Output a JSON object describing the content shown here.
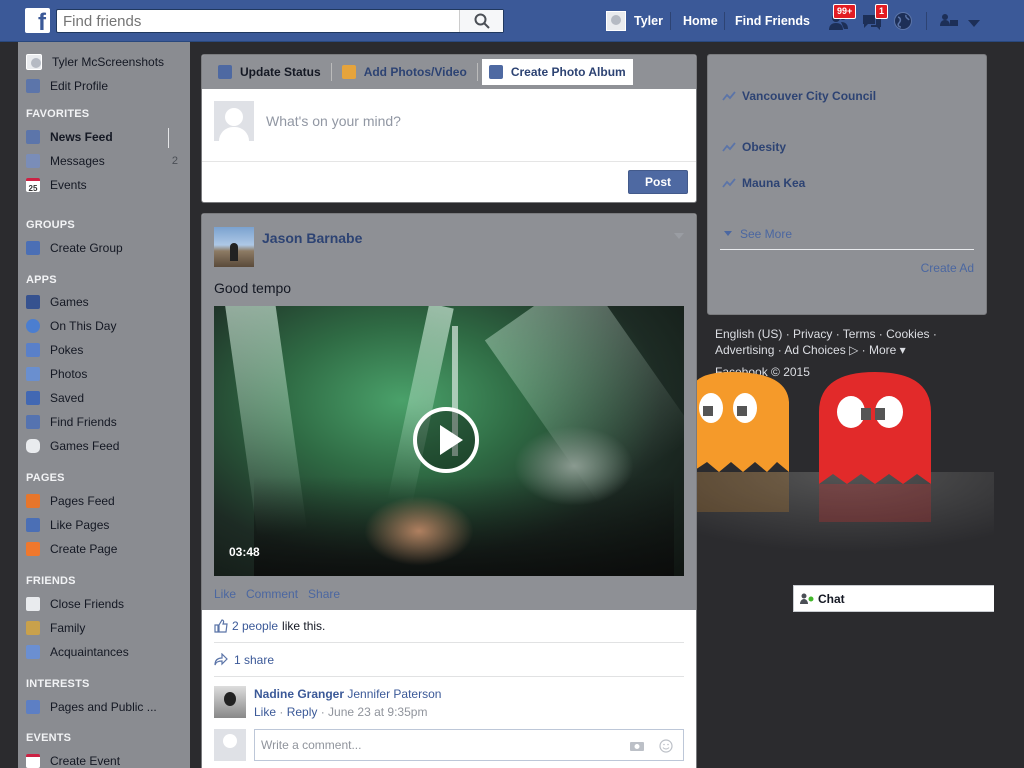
{
  "topbar": {
    "search_placeholder": "Find friends",
    "user_name": "Tyler",
    "home_label": "Home",
    "find_friends_label": "Find Friends",
    "friend_requests_badge": "99+",
    "messages_badge": "1"
  },
  "sidebar": {
    "profile_name": "Tyler McScreenshots",
    "edit_profile": "Edit Profile",
    "favorites_heading": "FAVORITES",
    "favorites": [
      {
        "label": "News Feed"
      },
      {
        "label": "Messages",
        "count": "2"
      },
      {
        "label": "Events"
      }
    ],
    "groups_heading": "GROUPS",
    "groups": [
      {
        "label": "Create Group"
      }
    ],
    "apps_heading": "APPS",
    "apps": [
      {
        "label": "Games"
      },
      {
        "label": "On This Day"
      },
      {
        "label": "Pokes"
      },
      {
        "label": "Photos"
      },
      {
        "label": "Saved"
      },
      {
        "label": "Find Friends"
      },
      {
        "label": "Games Feed"
      }
    ],
    "pages_heading": "PAGES",
    "pages": [
      {
        "label": "Pages Feed"
      },
      {
        "label": "Like Pages"
      },
      {
        "label": "Create Page"
      }
    ],
    "friends_heading": "FRIENDS",
    "friends": [
      {
        "label": "Close Friends"
      },
      {
        "label": "Family"
      },
      {
        "label": "Acquaintances"
      }
    ],
    "interests_heading": "INTERESTS",
    "interests": [
      {
        "label": "Pages and Public ..."
      }
    ],
    "events_heading": "EVENTS",
    "events": [
      {
        "label": "Create Event"
      }
    ]
  },
  "composer": {
    "tab_update_status": "Update Status",
    "tab_add_photos": "Add Photos/Video",
    "tab_create_album": "Create Photo Album",
    "placeholder": "What's on your mind?",
    "post_label": "Post"
  },
  "story": {
    "author": "Jason Barnabe",
    "text": "Good tempo",
    "video_duration": "03:48",
    "action_like": "Like",
    "action_comment": "Comment",
    "action_share": "Share",
    "likes_count": "2 people",
    "likes_suffix": "like this.",
    "shares": "1 share",
    "comment_author": "Nadine Granger",
    "comment_text": "Jennifer Paterson",
    "comment_like": "Like",
    "comment_reply": "Reply",
    "comment_time": "June 23 at 9:35pm",
    "write_comment_placeholder": "Write a comment..."
  },
  "trending": {
    "items": [
      {
        "label": "Vancouver City Council"
      },
      {
        "label": "Obesity"
      },
      {
        "label": "Mauna Kea"
      }
    ],
    "see_more": "See More",
    "create_ad": "Create Ad"
  },
  "footer": {
    "line1": "English (US) · Privacy · Terms · Cookies ·",
    "line2": "Advertising · Ad Choices ▷ · More ▾",
    "line3": "Facebook © 2015"
  },
  "chat": {
    "label": "Chat"
  },
  "colors": {
    "brand": "#3b5998",
    "link": "#3b5998",
    "badge": "#e31c23"
  }
}
